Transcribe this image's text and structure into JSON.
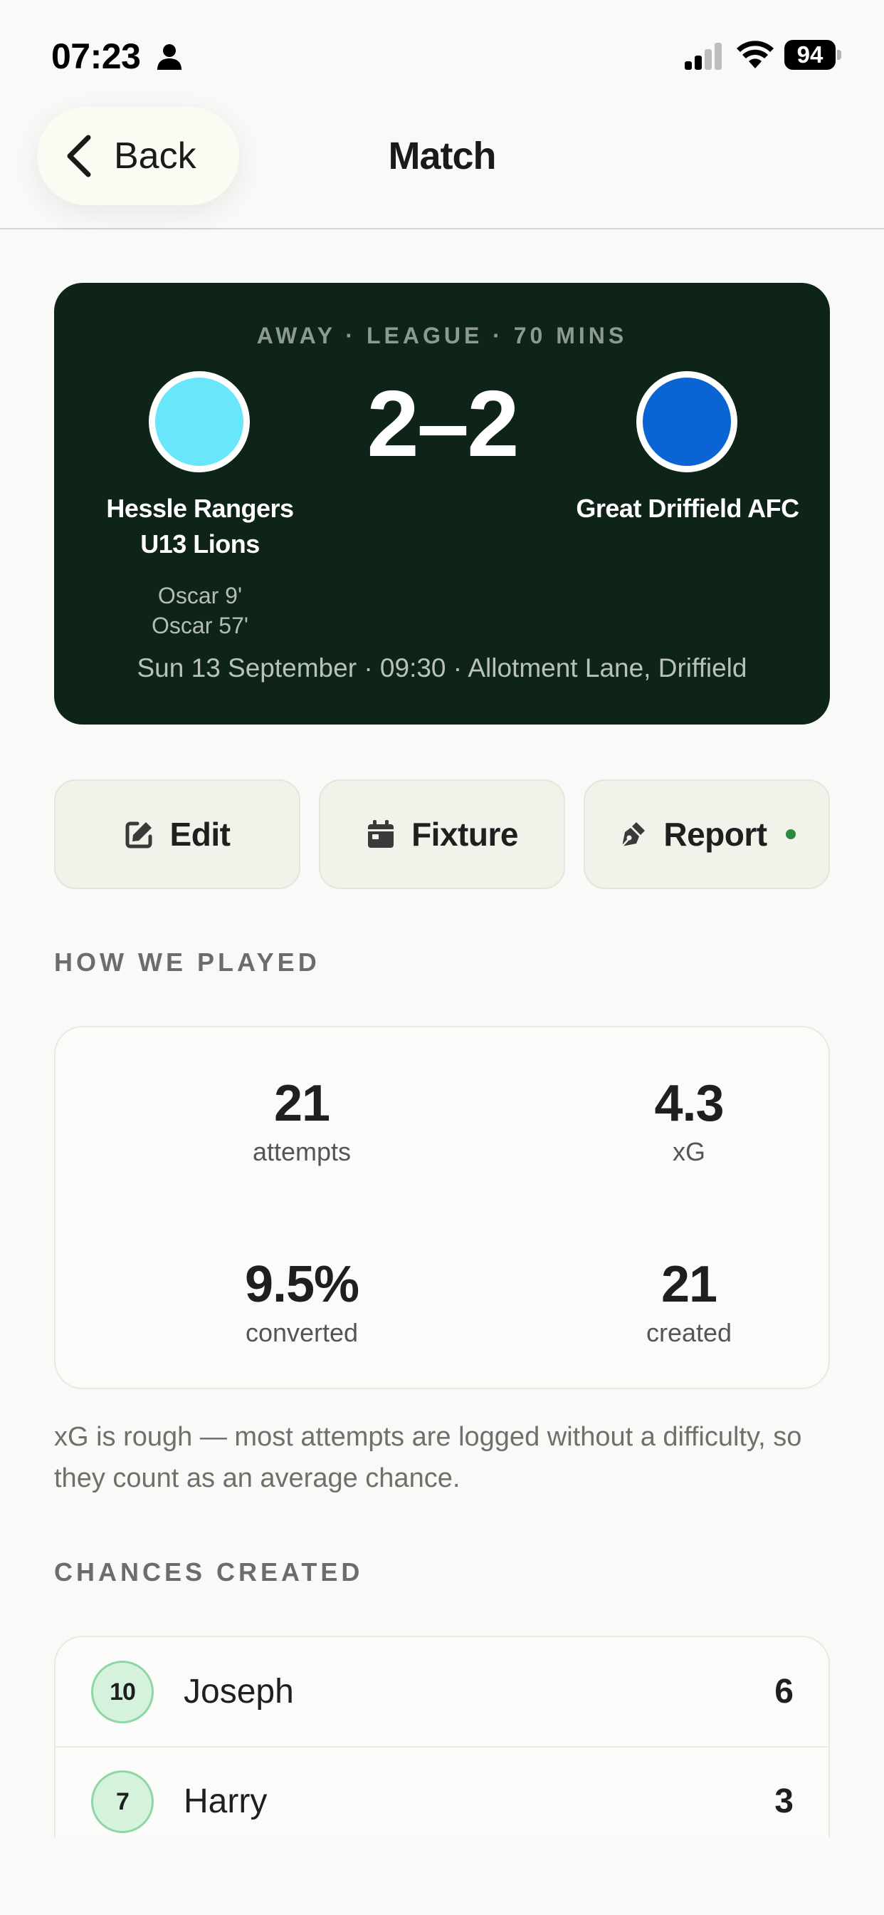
{
  "status_bar": {
    "time": "07:23",
    "battery": "94"
  },
  "nav": {
    "back_label": "Back",
    "title": "Match"
  },
  "match": {
    "meta": "AWAY · LEAGUE · 70 MINS",
    "home_team": "Hessle Rangers U13 Lions",
    "away_team": "Great Driffield AFC",
    "score": "2–2",
    "home_color": "#6ae6fb",
    "away_color": "#0a64d4",
    "scorers": [
      "Oscar 9'",
      "Oscar 57'"
    ],
    "info": "Sun 13 September · 09:30 · Allotment Lane, Driffield"
  },
  "actions": {
    "edit_label": "Edit",
    "fixture_label": "Fixture",
    "report_label": "Report"
  },
  "how_we_played": {
    "heading": "HOW WE PLAYED",
    "stats": [
      {
        "value": "21",
        "label": "attempts"
      },
      {
        "value": "4.3",
        "label": "xG"
      },
      {
        "value": "9.5%",
        "label": "converted"
      },
      {
        "value": "21",
        "label": "created"
      }
    ],
    "note": "xG is rough — most attempts are logged without a difficulty, so they count as an average chance."
  },
  "chances_created": {
    "heading": "CHANCES CREATED",
    "players": [
      {
        "number": "10",
        "name": "Joseph",
        "count": "6"
      },
      {
        "number": "7",
        "name": "Harry",
        "count": "3"
      }
    ]
  },
  "colors": {
    "card_bg": "#0f2418",
    "accent_green": "#2b8a3e"
  }
}
